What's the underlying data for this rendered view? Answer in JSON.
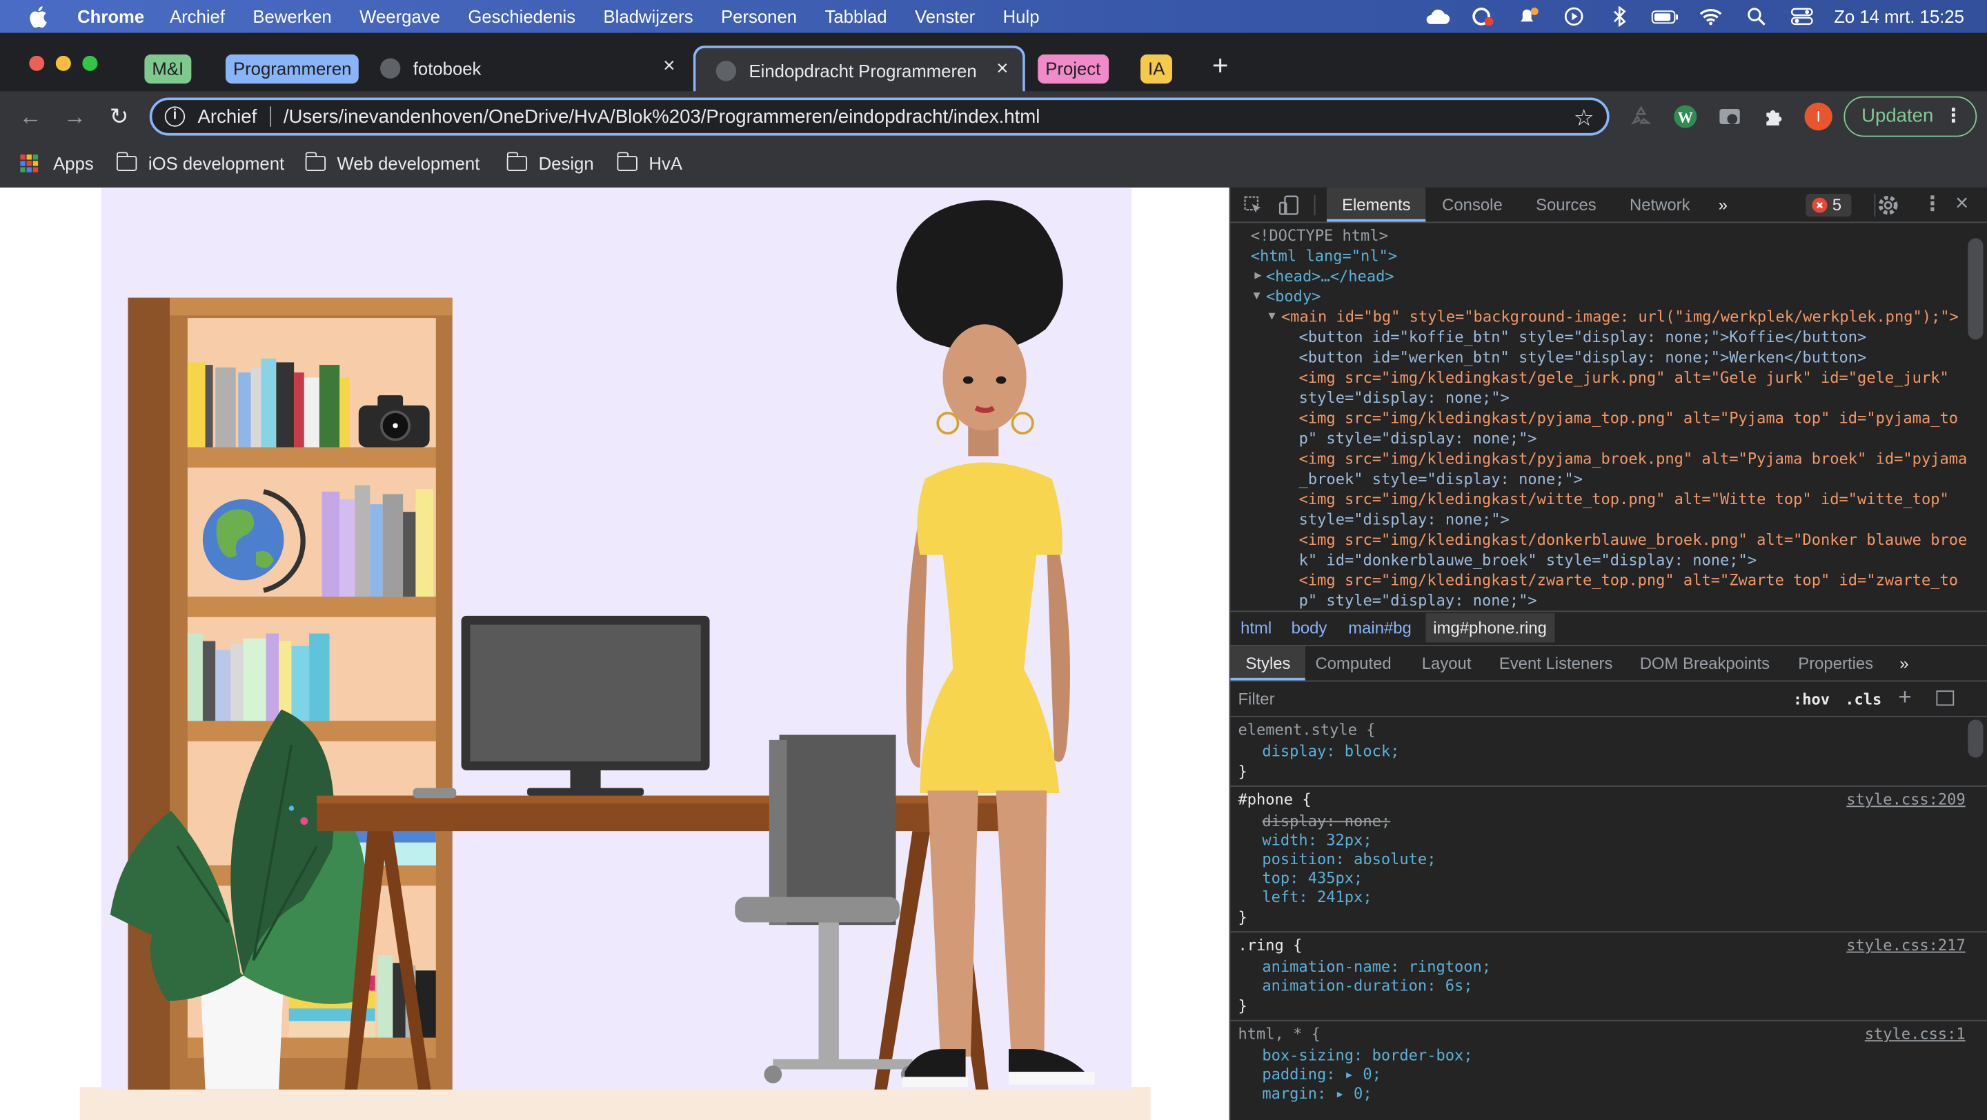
{
  "menubar": {
    "app_name": "Chrome",
    "items": [
      "Archief",
      "Bewerken",
      "Weergave",
      "Geschiedenis",
      "Bladwijzers",
      "Personen",
      "Tabblad",
      "Venster",
      "Hulp"
    ],
    "clock": "Zo 14 mrt.  15:25"
  },
  "tabs": [
    {
      "label": "M&I",
      "color": "#7fc98f"
    },
    {
      "label": "Programmeren",
      "color": "#8ab4f8"
    },
    {
      "label": "fotoboek"
    },
    {
      "label": "Eindopdracht Programmeren"
    },
    {
      "label": "Project",
      "color": "#f18ac9"
    },
    {
      "label": "IA",
      "color": "#f7c94a"
    }
  ],
  "omnibox": {
    "scheme": "Archief",
    "url": "/Users/inevandenhoven/OneDrive/HvA/Blok%203/Programmeren/eindopdracht/index.html"
  },
  "profile_initial": "I",
  "update_label": "Updaten",
  "bookmarks": [
    "Apps",
    "iOS development",
    "Web development",
    "Design",
    "HvA"
  ],
  "devtools": {
    "tabs": [
      "Elements",
      "Console",
      "Sources",
      "Network"
    ],
    "more": "»",
    "error_count": "5",
    "dom_lines": [
      "<!DOCTYPE html>",
      "<html lang=\"nl\">",
      "<head>…</head>",
      "<body>",
      "<main id=\"bg\" style=\"background-image: url(\"img/werkplek/werkplek.png\");\">",
      "<button id=\"koffie_btn\" style=\"display: none;\">Koffie</button>",
      "<button id=\"werken_btn\" style=\"display: none;\">Werken</button>",
      "<img src=\"img/kledingkast/gele_jurk.png\" alt=\"Gele jurk\" id=\"gele_jurk\"",
      "style=\"display: none;\">",
      "<img src=\"img/kledingkast/pyjama_top.png\" alt=\"Pyjama top\" id=\"pyjama_to",
      "p\" style=\"display: none;\">",
      "<img src=\"img/kledingkast/pyjama_broek.png\" alt=\"Pyjama broek\" id=\"pyjama",
      "_broek\" style=\"display: none;\">",
      "<img src=\"img/kledingkast/witte_top.png\" alt=\"Witte top\" id=\"witte_top\"",
      "style=\"display: none;\">",
      "<img src=\"img/kledingkast/donkerblauwe_broek.png\" alt=\"Donker blauwe broe",
      "k\" id=\"donkerblauwe_broek\" style=\"display: none;\">",
      "<img src=\"img/kledingkast/zwarte_top.png\" alt=\"Zwarte top\" id=\"zwarte_to",
      "p\" style=\"display: none;\">"
    ],
    "breadcrumbs": [
      "html",
      "body",
      "main#bg",
      "img#phone.ring"
    ],
    "subtabs": [
      "Styles",
      "Computed",
      "Layout",
      "Event Listeners",
      "DOM Breakpoints",
      "Properties"
    ],
    "filter_placeholder": "Filter",
    "hov": ":hov",
    "cls": ".cls",
    "rules": {
      "element_selector": "element.style {",
      "element_prop": "display: block;",
      "phone_selector": "#phone {",
      "phone_source": "style.css:209",
      "phone_props": [
        "display: none;",
        "width: 32px;",
        "position: absolute;",
        "top: 435px;",
        "left: 241px;"
      ],
      "ring_selector": ".ring {",
      "ring_source": "style.css:217",
      "ring_props": [
        "animation-name: ringtoon;",
        "animation-duration: 6s;"
      ],
      "html_selector": "html, * {",
      "html_source": "style.css:1",
      "html_props": [
        "box-sizing: border-box;",
        "padding: ▸ 0;",
        "margin: ▸ 0;"
      ],
      "close_brace": "}"
    }
  }
}
